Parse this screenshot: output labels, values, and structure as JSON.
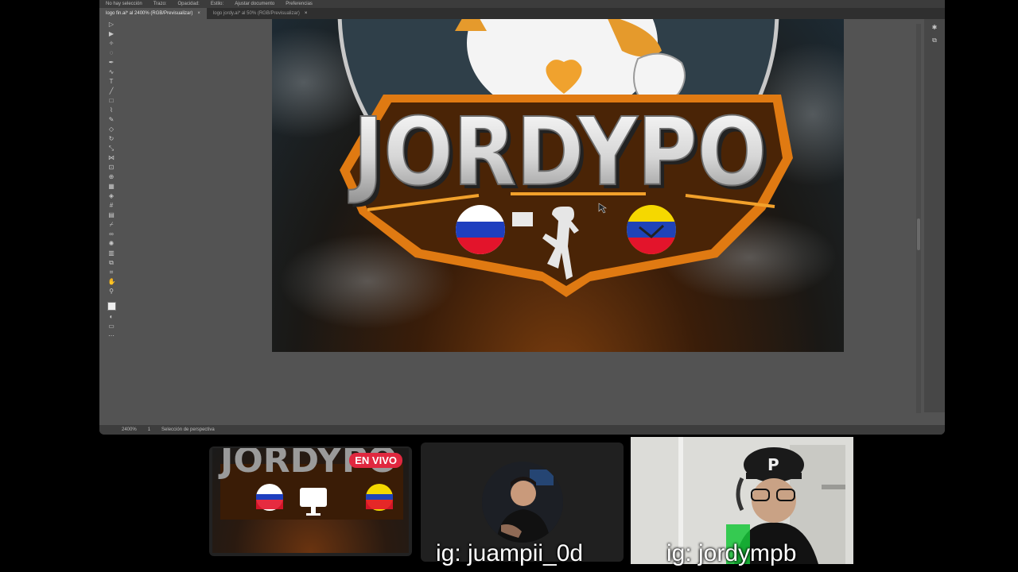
{
  "illustrator": {
    "topbar": [
      "No hay selección",
      "Trazo:",
      "Opacidad:",
      "Estilo:",
      "Ajustar documento",
      "Preferencias"
    ],
    "tabs": [
      {
        "label": "logo fin.ai* al 2400% (RGB/Previsualizar)",
        "active": true
      },
      {
        "label": "logo jordy.ai* al 50% (RGB/Previsualizar)",
        "active": false
      }
    ],
    "status": {
      "zoom": "2400%",
      "artboard": "1",
      "tool": "Selección de perspectiva"
    }
  },
  "artwork": {
    "logo_text": "JORDYPO",
    "colors": {
      "orange": "#e07a12",
      "brown": "#4a2406",
      "silver": "#d9d9d9",
      "background_top": "#1d2a33"
    }
  },
  "live_badge": "EN VIVO",
  "participants": [
    {
      "caption": "ig: juampii_0d"
    },
    {
      "caption": "ig: jordympb"
    }
  ]
}
